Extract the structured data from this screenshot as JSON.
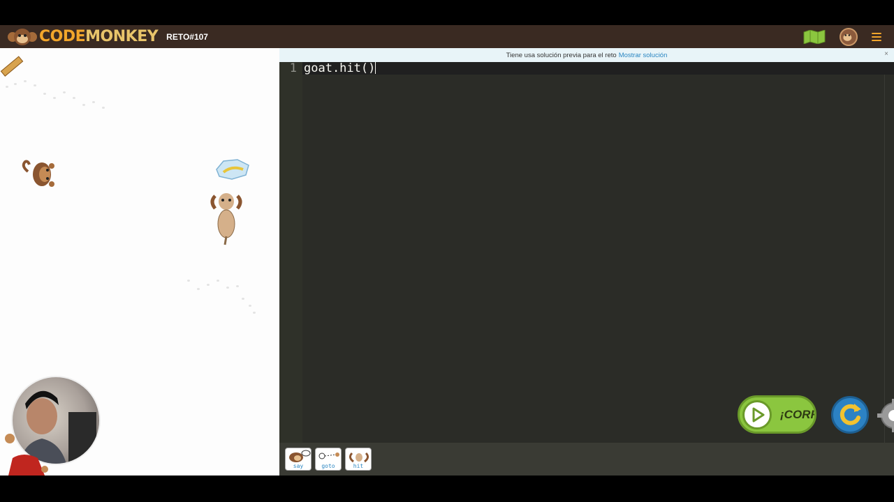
{
  "header": {
    "logo_text_a": "CODE",
    "logo_text_b": "MONKEY",
    "challenge": "RETO#107",
    "map_icon": "map-icon",
    "avatar_icon": "avatar-icon",
    "menu_icon": "hamburger-menu-icon"
  },
  "notice": {
    "text": "Tiene usa solución previa para el reto",
    "link": "Mostrar solución",
    "close": "×"
  },
  "editor": {
    "line_number": "1",
    "code": "goat.hit()"
  },
  "toolbox": {
    "tools": [
      {
        "label": "say"
      },
      {
        "label": "goto"
      },
      {
        "label": "hit"
      }
    ]
  },
  "controls": {
    "run_label": "¡CORRER",
    "reset_icon": "reset-icon",
    "settings_icon": "gear-icon"
  },
  "colors": {
    "topbar": "#3a2a22",
    "logo": "#f2a62b",
    "editor_bg": "#2b2c27",
    "run_green": "#8bc63f",
    "reset_blue": "#2c82c4",
    "link_blue": "#2a86c2"
  }
}
